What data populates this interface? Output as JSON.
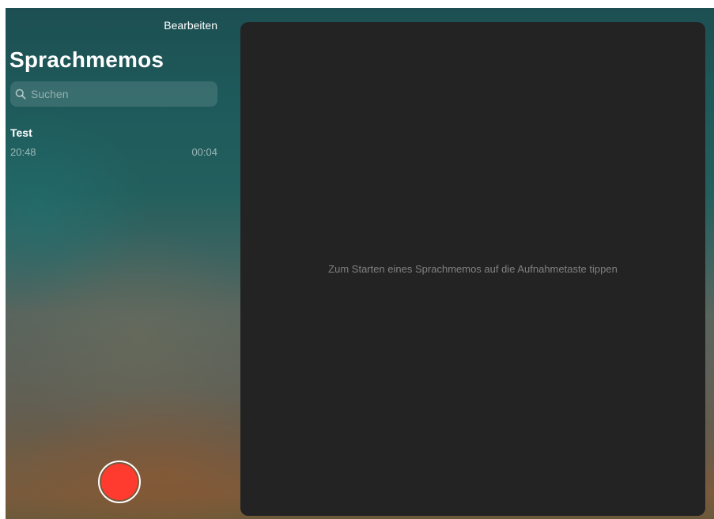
{
  "sidebar": {
    "edit_label": "Bearbeiten",
    "title": "Sprachmemos",
    "search": {
      "icon": "search-icon",
      "placeholder": "Suchen"
    },
    "memos": [
      {
        "title": "Test",
        "time": "20:48",
        "duration": "00:04"
      }
    ],
    "record_button": {
      "icon": "record-icon",
      "color": "#ff3b30"
    }
  },
  "detail": {
    "hint": "Zum Starten eines Sprachmemos auf die Aufnahmetaste tippen",
    "background": "#232324"
  }
}
